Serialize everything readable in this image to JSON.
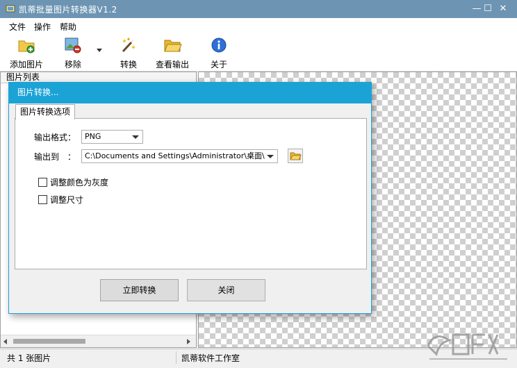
{
  "window": {
    "title": "凯蒂批量图片转换器V1.2",
    "minimize": "—",
    "maximize": "☐",
    "close": "✕"
  },
  "menu": {
    "items": [
      "文件",
      "操作",
      "帮助"
    ]
  },
  "toolbar": {
    "add_images": "添加图片",
    "remove": "移除",
    "convert": "转换",
    "view_output": "查看输出",
    "about": "关于"
  },
  "left_panel": {
    "header": "图片列表"
  },
  "status": {
    "count": "共 1 张图片",
    "studio": "凯蒂软件工作室"
  },
  "dialog": {
    "title": "图片转换...",
    "tab": "图片转换选项",
    "format_label": "输出格式：",
    "format_value": "PNG",
    "output_label": "输出到　：",
    "output_path": "C:\\Documents and Settings\\Administrator\\桌面\\",
    "option_grayscale": "调整颜色为灰度",
    "option_resize": "调整尺寸",
    "convert_now": "立即转换",
    "close": "关闭"
  },
  "icons": {
    "app": "app-icon",
    "add": "add-image-icon",
    "remove": "remove-image-icon",
    "convert": "magic-wand-icon",
    "folder": "folder-icon",
    "about": "info-icon"
  },
  "colors": {
    "titlebar": "#6d95b3",
    "dialog_accent": "#1ba3d6",
    "about_icon": "#2f6fd6",
    "folder": "#f1c84b"
  }
}
